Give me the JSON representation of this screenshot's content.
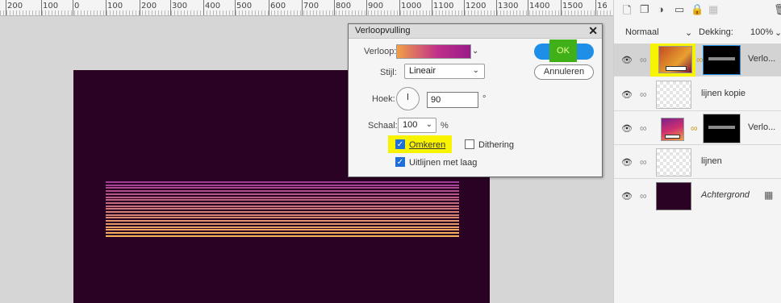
{
  "ruler": {
    "labels": [
      "200",
      "100",
      "0",
      "100",
      "200",
      "300",
      "400",
      "500",
      "600",
      "700",
      "800",
      "900",
      "1000",
      "1100",
      "1200",
      "1300",
      "1400",
      "1500",
      "16"
    ]
  },
  "dialog": {
    "title": "Verloopvulling",
    "close_glyph": "✕",
    "gradient_label": "Verloop:",
    "style_label": "Stijl:",
    "style_value": "Lineair",
    "angle_label": "Hoek:",
    "angle_value": "90",
    "angle_unit": "°",
    "scale_label": "Schaal:",
    "scale_value": "100",
    "scale_unit": "%",
    "ok_label": "OK",
    "cancel_label": "Annuleren",
    "reverse_label": "Omkeren",
    "reverse_checked": true,
    "dither_label": "Dithering",
    "dither_checked": false,
    "align_label": "Uitlijnen met laag",
    "align_checked": true
  },
  "layers_panel": {
    "blend_mode": "Normaal",
    "opacity_label": "Dekking:",
    "opacity_value": "100%",
    "layers": [
      {
        "name": "Verlo...",
        "type": "gradient-fill",
        "selected": true
      },
      {
        "name": "lijnen kopie",
        "type": "pixel",
        "selected": false
      },
      {
        "name": "Verlo...",
        "type": "gradient-fill",
        "selected": false
      },
      {
        "name": "lijnen",
        "type": "pixel",
        "selected": false
      },
      {
        "name": "Achtergrond",
        "type": "background",
        "selected": false
      }
    ]
  },
  "colors": {
    "document_bg": "#2a0224",
    "highlight_yellow": "#f8f400",
    "ok_green": "#3fb018",
    "accent_blue": "#1e8ee6"
  }
}
